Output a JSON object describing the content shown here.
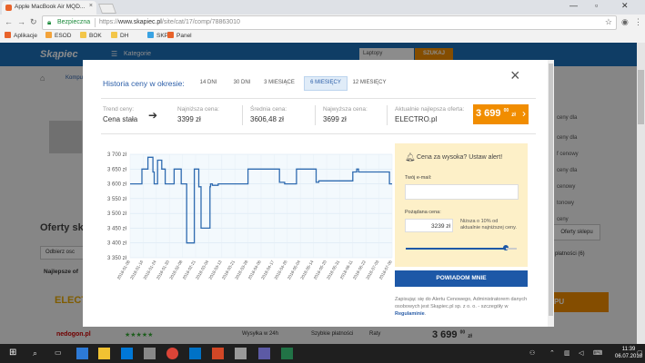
{
  "browser": {
    "tab_title": "Apple MacBook Air MQD...",
    "tab_close": "×",
    "security_label": "Bezpieczna",
    "url_scheme": "https://",
    "url_host": "www.skapiec.pl",
    "url_path": "/site/cat/17/comp/78863010",
    "bookmarks": [
      {
        "label": "Aplikacje",
        "color": "#e8632b"
      },
      {
        "label": "ESOD",
        "color": "#f3a33a"
      },
      {
        "label": "BOK",
        "color": "#f3c64a"
      },
      {
        "label": "DH",
        "color": "#f3c64a"
      },
      {
        "label": "SKP",
        "color": "#3aa3e3"
      },
      {
        "label": "Panel",
        "color": "#e8632b"
      }
    ]
  },
  "site": {
    "logo": "Skąpiec",
    "categories_label": "Kategorie",
    "search_value": "Laptopy",
    "search_button": "SZUKAJ",
    "breadcrumb_partial": "Kompu",
    "offers_heading": "Oferty sklep",
    "sort_label": "Odbierz osc",
    "cheapest_label": "Najlepsze of",
    "right_labels": [
      "ceny dla",
      "ceny dla",
      "f cenowy",
      "ceny dla",
      "cenowy",
      "tonowy",
      "ceny"
    ],
    "shop_button": "Oferty sklepu",
    "payments_label": "płatności (6)",
    "merchant_left": "ELECT",
    "row_shipping": "Wysyłka w 24h",
    "row_payment": "Szybkie płatności",
    "row_installments": "Raty",
    "row_price_main": "3 699",
    "row_price_sup": "00",
    "row_price_zl": "zł",
    "row_shop_partial": "nedogon.pl",
    "row_cta_partial": "PU"
  },
  "modal": {
    "title": "Historia ceny w okresie:",
    "periods": [
      {
        "label": "14 DNI",
        "active": false
      },
      {
        "label": "30 DNI",
        "active": false
      },
      {
        "label": "3 MIESIĄCE",
        "active": false
      },
      {
        "label": "6 MIESIĘCY",
        "active": true
      },
      {
        "label": "12 MIESIĘCY",
        "active": false
      }
    ],
    "close": "×",
    "stats": {
      "trend_label": "Trend ceny:",
      "trend_value": "Cena stała",
      "lowest_label": "Najniższa cena:",
      "lowest_value": "3399 zł",
      "average_label": "Średnia cena:",
      "average_value": "3606,48 zł",
      "highest_label": "Najwyższa cena:",
      "highest_value": "3699 zł",
      "current_label": "Aktualnie najlepsza oferta:",
      "current_value": "ELECTRO.pl",
      "current_price_main": "3 699",
      "current_price_sup": "00",
      "current_price_zl": "zł"
    },
    "alert": {
      "title": "Cena za wysoka? Ustaw alert!",
      "email_label": "Twój e-mail:",
      "email_value": "",
      "price_label": "Pożądana cena:",
      "price_value": "3239 zł",
      "note": "Niższa o 10% od aktualnie najniższej ceny.",
      "slider_level": 0.9,
      "button": "POWIADOM MNIE",
      "terms_text": "Zapisując się do Alertu Cenowego, Administratorem danych osobowych jest Skąpiec.pl sp. z o. o. - szczegóły w ",
      "terms_link": "Regulaminie",
      "terms_end": "."
    }
  },
  "chart_data": {
    "type": "line",
    "title": "",
    "xlabel": "",
    "ylabel": "",
    "ylim": [
      3350,
      3700
    ],
    "yticks": [
      3350,
      3400,
      3450,
      3500,
      3550,
      3600,
      3650,
      3700
    ],
    "ytick_labels": [
      "3 350 zł",
      "3 400 zł",
      "3 450 zł",
      "3 500 zł",
      "3 550 zł",
      "3 600 zł",
      "3 650 zł",
      "3 700 zł"
    ],
    "xtick_labels": [
      "2018-01-08",
      "2018-01-16",
      "2018-01-24",
      "2018-01-30",
      "2018-02-08",
      "2018-02-21",
      "2018-03-04",
      "2018-03-13",
      "2018-03-21",
      "2018-03-28",
      "2018-04-06",
      "2018-04-17",
      "2018-04-26",
      "2018-05-04",
      "2018-05-14",
      "2018-05-20",
      "2018-05-31",
      "2018-06-11",
      "2018-06-22",
      "2018-07-03",
      "2018-07-06"
    ],
    "grid": true,
    "color": "#2f6bb0",
    "series": [
      {
        "x": [
          0,
          4.5,
          4.5,
          6.8,
          6.8,
          8.7,
          8.7,
          9.2,
          9.2,
          10.5,
          10.5,
          12.1,
          12.1,
          13.4,
          13.4,
          16.8,
          16.8,
          19.5,
          19.5,
          21.6,
          21.6,
          22.5,
          22.5,
          22.7,
          22.7,
          24.5,
          24.5,
          26.2,
          26.2,
          27.1,
          27.1,
          30.5,
          30.5,
          30.7,
          30.7,
          31.4,
          31.4,
          33.6,
          33.6,
          45,
          45,
          57,
          57,
          59,
          59,
          63.5,
          63.5,
          71,
          71,
          72,
          72,
          85,
          85,
          86.5,
          86.5,
          87.2,
          87.2,
          99,
          99,
          100
        ],
        "y": [
          3600,
          3600,
          3650,
          3650,
          3690,
          3690,
          3640,
          3640,
          3600,
          3600,
          3680,
          3680,
          3650,
          3650,
          3600,
          3600,
          3650,
          3650,
          3600,
          3600,
          3400,
          3400,
          3400,
          3400,
          3400,
          3400,
          3650,
          3650,
          3590,
          3590,
          3450,
          3450,
          3590,
          3590,
          3600,
          3600,
          3595,
          3595,
          3600,
          3600,
          3650,
          3650,
          3605,
          3605,
          3600,
          3600,
          3650,
          3650,
          3605,
          3605,
          3610,
          3610,
          3640,
          3640,
          3650,
          3650,
          3640,
          3640,
          3600,
          3600
        ]
      }
    ]
  }
}
